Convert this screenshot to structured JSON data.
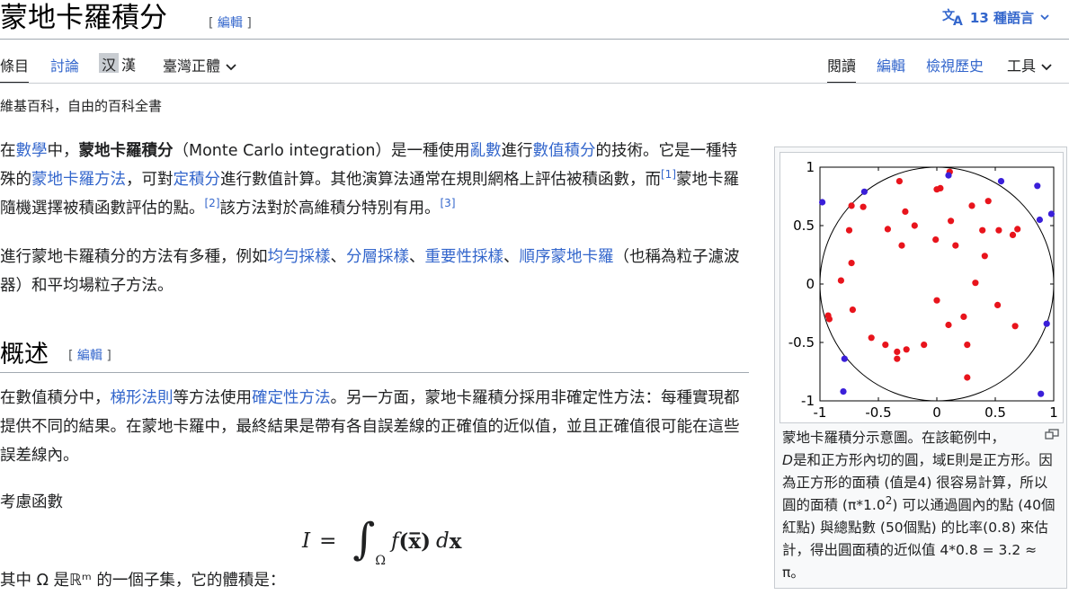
{
  "header": {
    "title": "蒙地卡羅積分",
    "edit_open": "[ ",
    "edit_label": "編輯",
    "edit_close": " ]",
    "languages": "13 種語言",
    "lang_icon": "translate-icon"
  },
  "tabs": {
    "article": "條目",
    "talk": "討論",
    "variant_hans": "汉",
    "variant_hant": "漢",
    "variant_current": "臺灣正體",
    "read": "閱讀",
    "edit": "編輯",
    "history": "檢視歷史",
    "tools": "工具"
  },
  "tagline": "維基百科，自由的百科全書",
  "p1": {
    "s1": "在",
    "l_math": "數學",
    "s2": "中，",
    "bold": "蒙地卡羅積分",
    "s3": "（Monte Carlo integration）是一種使用",
    "l_random": "亂數",
    "s4": "進行",
    "l_numint": "數值積分",
    "s5": "的技術。它是一種特殊的",
    "l_mc": "蒙地卡羅方法",
    "s6": "，可對",
    "l_defint": "定積分",
    "s7": "進行數值計算。其他演算法通常在規則網格上評估被積函數，而",
    "ref1": "[1]",
    "s8": "蒙地卡羅隨機選擇被積函數評估的點。",
    "ref2": "[2]",
    "s9": "該方法對於高維積分特別有用。",
    "ref3": "[3]"
  },
  "p2": {
    "s1": "進行蒙地卡羅積分的方法有多種，例如",
    "l_uniform": "均勻採樣",
    "sep1": "、",
    "l_strat": "分層採樣",
    "sep2": "、",
    "l_importance": "重要性採樣",
    "sep3": "、",
    "l_sequential": "順序蒙地卡羅",
    "s2": "（也稱為粒子濾波器）和平均場粒子方法。"
  },
  "section": {
    "title": "概述",
    "edit_open": "[ ",
    "edit_label": "編輯",
    "edit_close": " ]"
  },
  "p3": {
    "s1": "在數值積分中，",
    "l_trap": "梯形法則",
    "s2": "等方法使用",
    "l_det": "確定性方法",
    "s3": "。另一方面，蒙地卡羅積分採用非確定性方法：每種實現都提供不同的結果。在蒙地卡羅中，最終結果是帶有各自誤差線的正確值的近似值，並且正確值很可能在這些誤差線內。"
  },
  "p4": "考慮函數",
  "formula": {
    "lhs": "I",
    "eq": "=",
    "integral": "∫",
    "sub": "Ω",
    "f": "f",
    "arg": "(x̅)",
    "dx": "d",
    "xb": "x"
  },
  "p5": "其中 Ω 是ℝᵐ 的一個子集，它的體積是：",
  "thumb": {
    "caption_1": "蒙地卡羅積分示意圖。在該範例中，",
    "caption_D": "D",
    "caption_2": "是和正方形內切的圓，域E則是正方形。因為正方形的面積 (值是4) 很容易計算，所以圓的面積 (π*1.0",
    "caption_sup": "2",
    "caption_3": ") 可以通過圓內的點 (40個紅點) 與總點數 (50個點) 的比率(0.8) 來估計，得出圓面積的近似值 4*0.8 = 3.2 ≈ π。",
    "magnify_icon": "magnify-icon"
  },
  "chart_data": {
    "type": "scatter",
    "title": "",
    "xlabel": "",
    "ylabel": "",
    "xlim": [
      -1,
      1
    ],
    "ylim": [
      -1,
      1
    ],
    "x_ticks": [
      "-1",
      "-0.5",
      "0",
      "0.5",
      "1"
    ],
    "y_ticks": [
      "1",
      "0.5",
      "0",
      "-0.5",
      "-1"
    ],
    "grid": false,
    "circle_radius": 1,
    "inside_color": "#e8141c",
    "outside_color": "#3a1fd9",
    "series": [
      {
        "points": [
          [
            0.11,
            0.96
          ],
          [
            -0.32,
            0.88
          ],
          [
            0.0,
            0.81
          ],
          [
            0.03,
            0.82
          ],
          [
            0.44,
            0.71
          ],
          [
            -0.73,
            0.67
          ],
          [
            -0.63,
            0.66
          ],
          [
            0.3,
            0.67
          ],
          [
            -0.27,
            0.62
          ],
          [
            -0.19,
            0.5
          ],
          [
            0.12,
            0.54
          ],
          [
            0.39,
            0.46
          ],
          [
            -0.75,
            0.46
          ],
          [
            -0.42,
            0.47
          ],
          [
            0.53,
            0.46
          ],
          [
            -0.01,
            0.38
          ],
          [
            0.16,
            0.33
          ],
          [
            -0.3,
            0.33
          ],
          [
            0.65,
            0.42
          ],
          [
            0.69,
            0.47
          ],
          [
            0.41,
            0.24
          ],
          [
            -0.73,
            0.18
          ],
          [
            -0.82,
            0.03
          ],
          [
            0.33,
            0.01
          ],
          [
            -0.72,
            -0.22
          ],
          [
            -0.93,
            -0.27
          ],
          [
            -0.92,
            -0.3
          ],
          [
            0.0,
            -0.14
          ],
          [
            0.52,
            -0.18
          ],
          [
            0.23,
            -0.28
          ],
          [
            0.1,
            -0.35
          ],
          [
            0.67,
            -0.36
          ],
          [
            -0.56,
            -0.46
          ],
          [
            -0.44,
            -0.52
          ],
          [
            -0.34,
            -0.58
          ],
          [
            -0.26,
            -0.56
          ],
          [
            -0.11,
            -0.52
          ],
          [
            0.26,
            -0.52
          ],
          [
            -0.34,
            -0.64
          ],
          [
            0.26,
            -0.8
          ]
        ]
      },
      {
        "points": [
          [
            0.1,
            0.93
          ],
          [
            -0.98,
            0.7
          ],
          [
            -0.62,
            0.79
          ],
          [
            0.55,
            0.88
          ],
          [
            0.86,
            0.84
          ],
          [
            0.98,
            0.6
          ],
          [
            0.88,
            0.55
          ],
          [
            0.94,
            -0.34
          ],
          [
            -0.79,
            -0.64
          ],
          [
            -0.8,
            -0.92
          ],
          [
            0.89,
            -0.94
          ]
        ]
      }
    ]
  }
}
